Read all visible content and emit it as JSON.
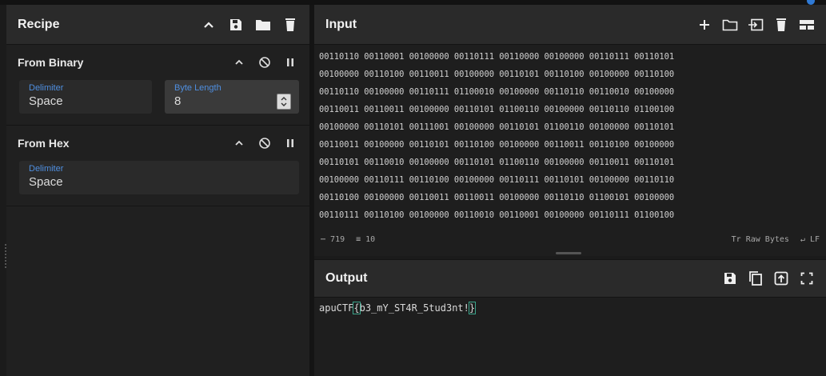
{
  "recipe": {
    "title": "Recipe",
    "operations": [
      {
        "title": "From Binary",
        "fields": [
          {
            "label": "Delimiter",
            "value": "Space"
          },
          {
            "label": "Byte Length",
            "value": "8"
          }
        ]
      },
      {
        "title": "From Hex",
        "fields": [
          {
            "label": "Delimiter",
            "value": "Space"
          }
        ]
      }
    ]
  },
  "input": {
    "title": "Input",
    "lines": [
      "00110110 00110001 00100000 00110111 00110000 00100000 00110111 00110101",
      "00100000 00110100 00110011 00100000 00110101 00110100 00100000 00110100",
      "00110110 00100000 00110111 01100010 00100000 00110110 00110010 00100000",
      "00110011 00110011 00100000 00110101 01100110 00100000 00110110 01100100",
      "00100000 00110101 00111001 00100000 00110101 01100110 00100000 00110101",
      "00110011 00100000 00110101 00110100 00100000 00110011 00110100 00100000",
      "00110101 00110010 00100000 00110101 01100110 00100000 00110011 00110101",
      "00100000 00110111 00110100 00100000 00110111 00110101 00100000 00110110",
      "00110100 00100000 00110011 00110011 00100000 00110110 01100101 00100000",
      "00110111 00110100 00100000 00110010 00110001 00100000 00110111 01100100"
    ],
    "status": {
      "length": "719",
      "lines": "10",
      "encoding": "Raw Bytes",
      "eol": "LF"
    }
  },
  "output": {
    "title": "Output",
    "prefix": "apuCTF",
    "open": "{",
    "body": "b3_mY_ST4R_5tud3nt!",
    "close": "}"
  }
}
